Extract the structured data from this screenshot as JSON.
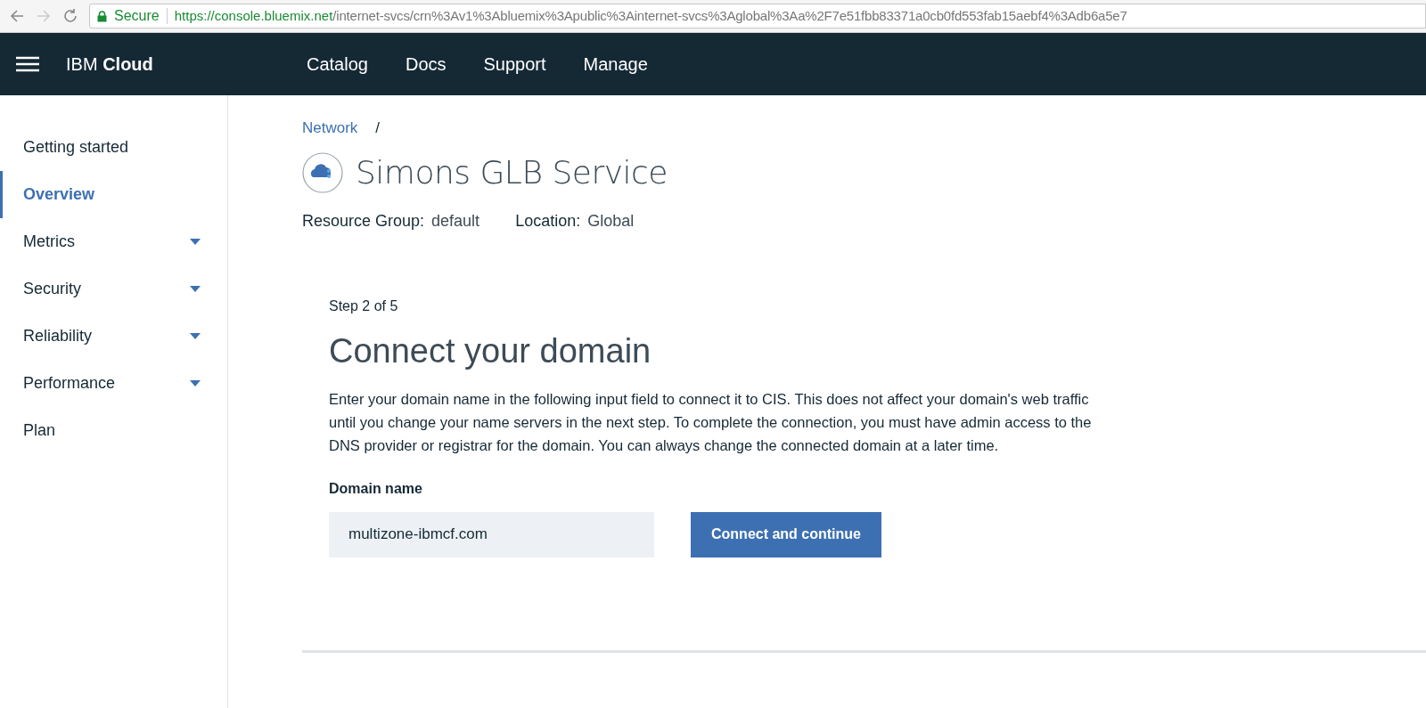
{
  "browser": {
    "secure_label": "Secure",
    "url_host": "https://console.bluemix.net",
    "url_path": "/internet-svcs/crn%3Av1%3Abluemix%3Apublic%3Ainternet-svcs%3Aglobal%3Aa%2F7e51fbb83371a0cb0fd553fab15aebf4%3Adb6a5e7"
  },
  "header": {
    "brand_prefix": "IBM",
    "brand_name": "Cloud",
    "nav": [
      "Catalog",
      "Docs",
      "Support",
      "Manage"
    ]
  },
  "sidebar": {
    "items": [
      {
        "label": "Getting started",
        "selected": false,
        "expandable": false
      },
      {
        "label": "Overview",
        "selected": true,
        "expandable": false
      },
      {
        "label": "Metrics",
        "selected": false,
        "expandable": true
      },
      {
        "label": "Security",
        "selected": false,
        "expandable": true
      },
      {
        "label": "Reliability",
        "selected": false,
        "expandable": true
      },
      {
        "label": "Performance",
        "selected": false,
        "expandable": true
      },
      {
        "label": "Plan",
        "selected": false,
        "expandable": false
      }
    ]
  },
  "breadcrumb": {
    "link": "Network",
    "separator": "/"
  },
  "service": {
    "title": "Simons GLB Service",
    "meta": [
      {
        "label": "Resource Group:",
        "value": "default"
      },
      {
        "label": "Location:",
        "value": "Global"
      }
    ]
  },
  "step": {
    "counter": "Step 2 of 5",
    "heading": "Connect your domain",
    "description": "Enter your domain name in the following input field to connect it to CIS. This does not affect your domain's web traffic until you change your name servers in the next step. To complete the connection, you must have admin access to the DNS provider or registrar for the domain. You can always change the connected domain at a later time.",
    "field_label": "Domain name",
    "field_value": "multizone-ibmcf.com",
    "button": "Connect and continue"
  }
}
